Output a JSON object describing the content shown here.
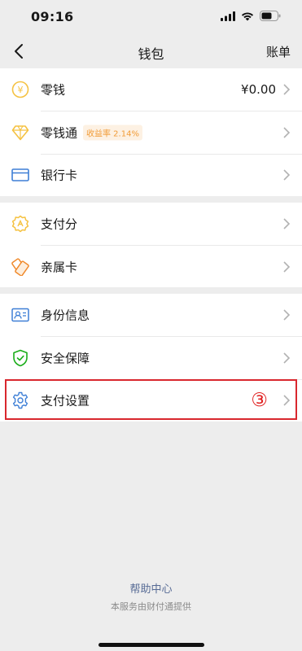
{
  "status_bar": {
    "time": "09:16"
  },
  "nav": {
    "title": "钱包",
    "right_action": "账单"
  },
  "groups": [
    {
      "items": [
        {
          "label": "零钱",
          "value": "¥0.00",
          "icon": "coin-icon"
        },
        {
          "label": "零钱通",
          "badge": "收益率 2.14%",
          "icon": "diamond-icon"
        },
        {
          "label": "银行卡",
          "icon": "bank-card-icon"
        }
      ]
    },
    {
      "items": [
        {
          "label": "支付分",
          "icon": "pay-score-icon"
        },
        {
          "label": "亲属卡",
          "icon": "family-card-icon"
        }
      ]
    },
    {
      "items": [
        {
          "label": "身份信息",
          "icon": "id-card-icon"
        },
        {
          "label": "安全保障",
          "icon": "shield-check-icon"
        },
        {
          "label": "支付设置",
          "icon": "gear-icon",
          "marker": "③"
        }
      ]
    }
  ],
  "footer": {
    "help": "帮助中心",
    "provider": "本服务由财付通提供"
  },
  "colors": {
    "yellow": "#f5c242",
    "blue": "#3e7fd6",
    "green": "#1aad19",
    "orange": "#f08a2c",
    "highlight": "#d9272e",
    "link": "#576b95"
  }
}
